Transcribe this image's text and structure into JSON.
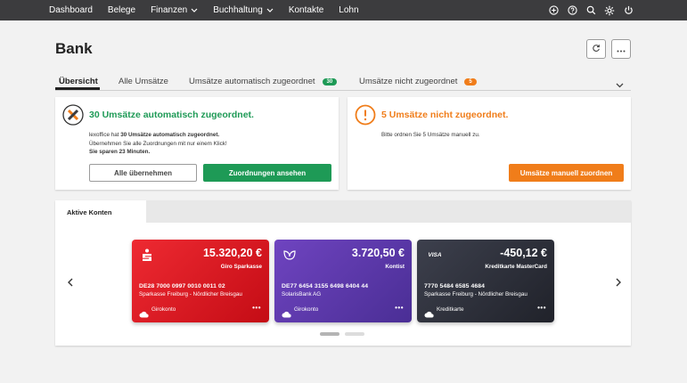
{
  "nav": {
    "items": [
      {
        "label": "Dashboard",
        "has_dropdown": false
      },
      {
        "label": "Belege",
        "has_dropdown": false
      },
      {
        "label": "Finanzen",
        "has_dropdown": true
      },
      {
        "label": "Buchhaltung",
        "has_dropdown": true
      },
      {
        "label": "Kontakte",
        "has_dropdown": false
      },
      {
        "label": "Lohn",
        "has_dropdown": false
      }
    ],
    "icons": [
      "plus-circle-icon",
      "help-icon",
      "search-icon",
      "gear-icon",
      "power-icon"
    ]
  },
  "header": {
    "title": "Bank",
    "actions": [
      "refresh-icon",
      "more-icon"
    ]
  },
  "tabs": [
    {
      "label": "Übersicht",
      "active": true,
      "badge": null
    },
    {
      "label": "Alle Umsätze",
      "active": false,
      "badge": null
    },
    {
      "label": "Umsätze automatisch zugeordnet",
      "active": false,
      "badge": "30",
      "badge_color": "#1e9a56"
    },
    {
      "label": "Umsätze nicht zugeordnet",
      "active": false,
      "badge": "5",
      "badge_color": "#f07d1a"
    }
  ],
  "auto_card": {
    "title": "30 Umsätze automatisch zugeordnet.",
    "line1_prefix": "lexoffice hat ",
    "line1_bold": "30 Umsätze automatisch zugeordnet.",
    "line2": "Übernehmen Sie alle Zuordnungen mit nur einem Klick!",
    "line3": "Sie sparen 23 Minuten.",
    "btn_secondary": "Alle übernehmen",
    "btn_primary": "Zuordnungen ansehen"
  },
  "manual_card": {
    "title": "5 Umsätze nicht zugeordnet.",
    "text": "Bitte ordnen Sie 5 Umsätze manuell zu.",
    "btn_primary": "Umsätze manuell zuordnen"
  },
  "accounts_panel": {
    "tab_label": "Aktive Konten",
    "accounts": [
      {
        "amount": "15.320,20 €",
        "name": "Giro Sparkasse",
        "iban": "DE28 7000 0997 0010 0011 02",
        "bank": "Sparkasse Freiburg - Nördlicher Breisgau",
        "type": "Girokonto",
        "logo": "sparkasse-icon",
        "color_from": "#e8242e",
        "color_to": "#c70d16"
      },
      {
        "amount": "3.720,50 €",
        "name": "Kontist",
        "iban": "DE77 6454 3155 6498 6404 44",
        "bank": "SolarisBank AG",
        "type": "Girokonto",
        "logo": "kontist-leaf-icon",
        "color_from": "#6a3fb8",
        "color_to": "#4b2f96"
      },
      {
        "amount": "-450,12 €",
        "name": "Kreditkarte MasterCard",
        "iban": "7770 5484 6585 4684",
        "bank": "Sparkasse Freiburg - Nördlicher Breisgau",
        "type": "Kreditkarte",
        "logo_text": "VISA",
        "color_from": "#3a3d4a",
        "color_to": "#23252e"
      }
    ],
    "more_label": "•••"
  },
  "colors": {
    "green": "#1e9a56",
    "orange": "#f07d1a",
    "nav_bg": "#3c3c3e"
  }
}
